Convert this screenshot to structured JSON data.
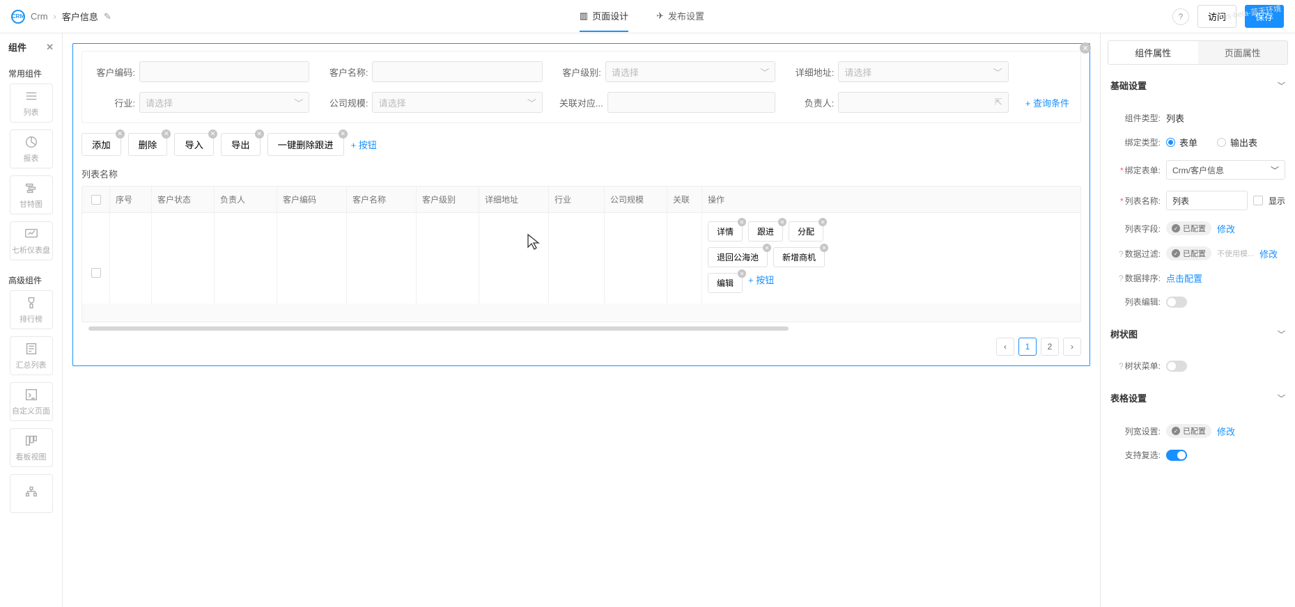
{
  "header": {
    "app": "Crm",
    "page": "客户信息",
    "tabs": {
      "design": "页面设计",
      "publish": "发布设置"
    },
    "visit": "访问",
    "save": "保存"
  },
  "sidebar": {
    "title": "组件",
    "groups": {
      "common": {
        "title": "常用组件",
        "items": [
          "列表",
          "报表",
          "甘特图",
          "七析仪表盘"
        ]
      },
      "advanced": {
        "title": "高级组件",
        "items": [
          "排行榜",
          "汇总列表",
          "自定义页面",
          "看板视图",
          ""
        ]
      }
    }
  },
  "filters": {
    "labels": [
      "客户编码:",
      "客户名称:",
      "客户级别:",
      "详细地址:",
      "行业:",
      "公司规模:",
      "关联对应...",
      "负责人:"
    ],
    "placeholder": "请选择",
    "addCond": "+ 查询条件"
  },
  "toolbar": {
    "buttons": [
      "添加",
      "删除",
      "导入",
      "导出",
      "一键删除跟进"
    ],
    "addBtn": "+ 按钮"
  },
  "table": {
    "title": "列表名称",
    "columns": [
      "序号",
      "客户状态",
      "负责人",
      "客户编码",
      "客户名称",
      "客户级别",
      "详细地址",
      "行业",
      "公司规模",
      "关联",
      "操作"
    ],
    "actions": [
      "详情",
      "跟进",
      "分配",
      "退回公海池",
      "新增商机",
      "编辑"
    ],
    "addAction": "+ 按钮"
  },
  "pagination": {
    "pages": [
      "1",
      "2"
    ]
  },
  "rightPanel": {
    "tabs": {
      "comp": "组件属性",
      "page": "页面属性"
    },
    "sections": {
      "basic": {
        "title": "基础设置",
        "compTypeLabel": "组件类型:",
        "compTypeVal": "列表",
        "bindTypeLabel": "绑定类型:",
        "bindFormRadio": "表单",
        "bindOutRadio": "输出表",
        "bindFormLabel": "绑定表单:",
        "bindFormVal": "Crm/客户信息",
        "listNameLabel": "列表名称:",
        "listNameVal": "列表",
        "showLabel": "显示",
        "listFieldLabel": "列表字段:",
        "configured": "已配置",
        "modify": "修改",
        "dataFilterLabel": "数据过滤:",
        "noTemplate": "不使用模...",
        "dataSortLabel": "数据排序:",
        "clickConfig": "点击配置",
        "listEditLabel": "列表编辑:"
      },
      "tree": {
        "title": "树状图",
        "treeMenuLabel": "树状菜单:"
      },
      "tableSet": {
        "title": "表格设置",
        "colWidthLabel": "列宽设置:",
        "multiSelectLabel": "支持复选:"
      }
    }
  },
  "watermark": "aas-beta-蓝天环境"
}
